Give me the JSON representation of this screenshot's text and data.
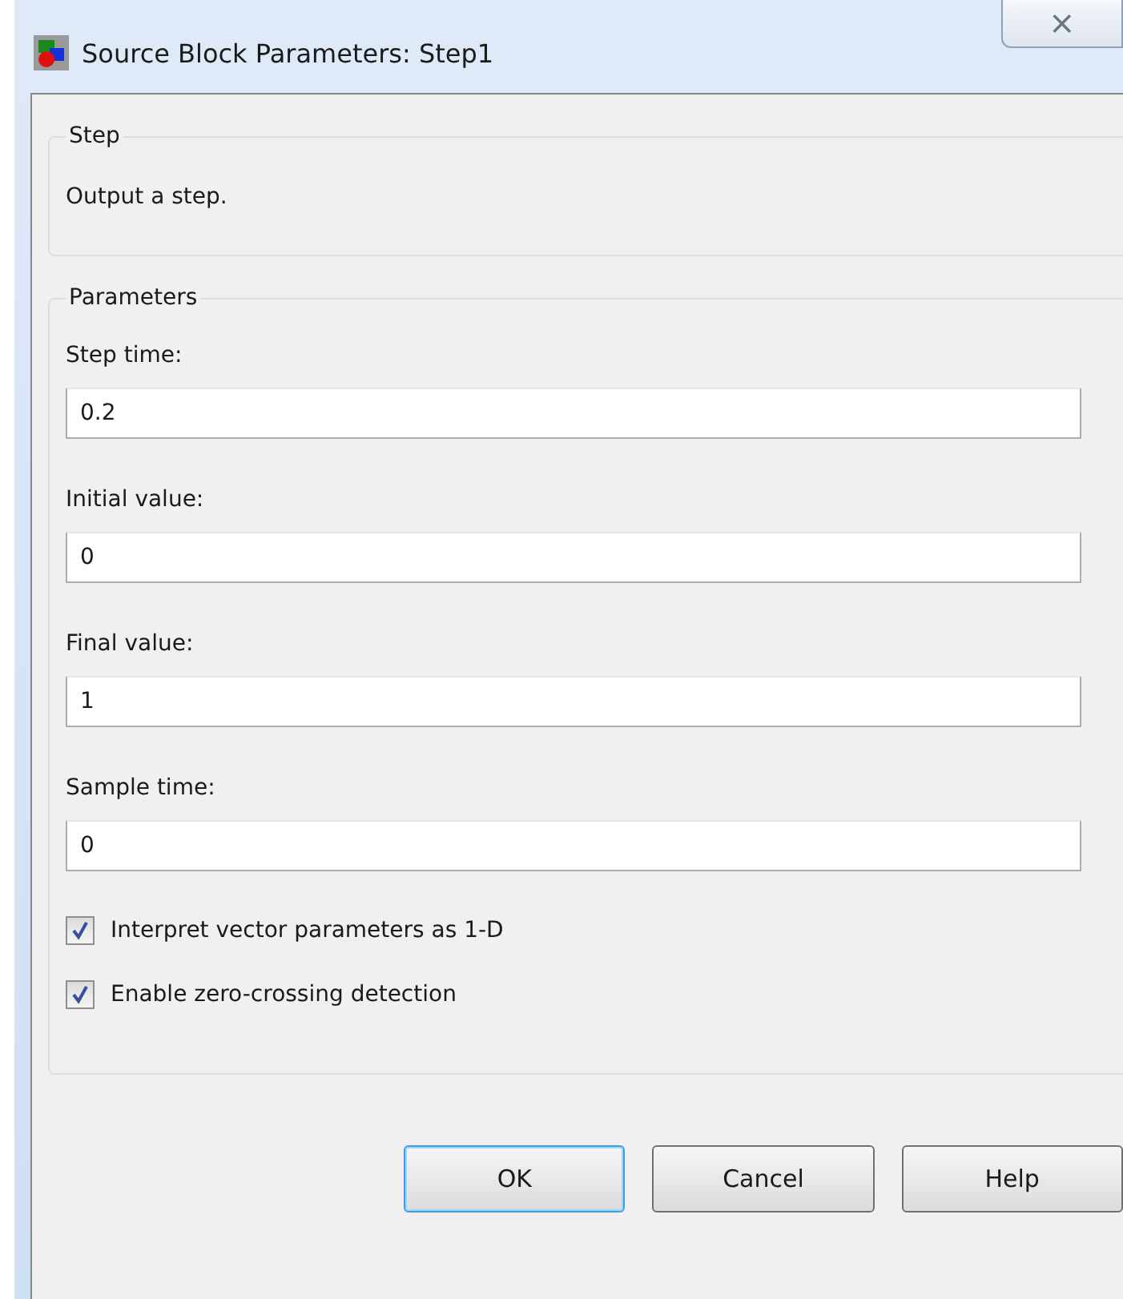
{
  "window": {
    "title": "Source Block Parameters: Step1",
    "close": "⨯"
  },
  "description_group": {
    "title": "Step",
    "text": "Output a step."
  },
  "parameters_group": {
    "title": "Parameters",
    "fields": [
      {
        "label": "Step time:",
        "value": "0.2"
      },
      {
        "label": "Initial value:",
        "value": "0"
      },
      {
        "label": "Final value:",
        "value": "1"
      },
      {
        "label": "Sample time:",
        "value": "0"
      }
    ],
    "checkboxes": [
      {
        "label": "Interpret vector parameters as 1-D",
        "checked": true
      },
      {
        "label": "Enable zero-crossing detection",
        "checked": true
      }
    ]
  },
  "buttons": [
    {
      "label": "OK",
      "selected": true
    },
    {
      "label": "Cancel",
      "selected": false
    },
    {
      "label": "Help",
      "selected": false
    }
  ]
}
